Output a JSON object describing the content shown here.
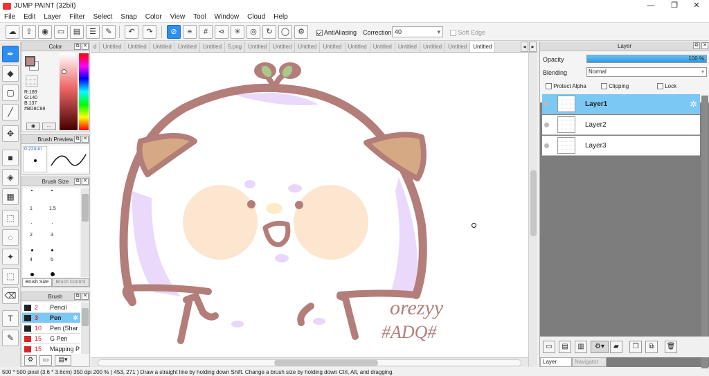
{
  "app": {
    "title": "JUMP PAINT (32bit)"
  },
  "window_controls": {
    "minimize": "—",
    "restore": "❐",
    "close": "✕"
  },
  "menu": [
    "File",
    "Edit",
    "Layer",
    "Filter",
    "Select",
    "Snap",
    "Color",
    "View",
    "Tool",
    "Window",
    "Cloud",
    "Help"
  ],
  "toolbar": {
    "antialiasing_label": "AntiAliasing",
    "antialiasing_checked": true,
    "correction_label": "Correction",
    "correction_value": "40",
    "soft_edge_label": "Soft Edge",
    "soft_edge_checked": false
  },
  "color_panel": {
    "title": "Color",
    "r": "R:189",
    "g": "G:140",
    "b": "B:137",
    "hex": "#BD8C89",
    "main_color": "#bd8c89"
  },
  "brush_preview": {
    "title": "Brush Preview",
    "size": "0.22mm"
  },
  "brush_size": {
    "title": "Brush Size",
    "values": [
      "1",
      "1.5",
      "·",
      "·",
      "2",
      "3",
      "4",
      "5"
    ],
    "tab_size": "Brush Size",
    "tab_control": "Brush Control"
  },
  "brush_panel": {
    "title": "Brush",
    "items": [
      {
        "num": "2",
        "name": "Pencil",
        "color": "#222222"
      },
      {
        "num": "3",
        "name": "Pen",
        "color": "#222222"
      },
      {
        "num": "10",
        "name": "Pen (Shar",
        "color": "#222222"
      },
      {
        "num": "15",
        "name": "G Pen",
        "color": "#d6242b"
      },
      {
        "num": "15",
        "name": "Mapping P",
        "color": "#d6242b"
      }
    ],
    "selected_index": 1
  },
  "tabs": [
    "d",
    "Untitled",
    "Untitled",
    "Untitled",
    "Untitled",
    "Untitled",
    "5.png",
    "Untitled",
    "Untitled",
    "Untitled",
    "Untitled",
    "Untitled",
    "Untitled",
    "Untitled",
    "Untitled",
    "Untitled",
    "Untitled"
  ],
  "active_tab_index": 16,
  "canvas": {
    "signature_line1": "orezyy",
    "signature_line2": "#ADQ#"
  },
  "layer_panel": {
    "title": "Layer",
    "opacity_label": "Opacity",
    "opacity_value": "100 %",
    "opacity_fraction": 1.0,
    "blending_label": "Blending",
    "blending_value": "Normal",
    "protect_alpha": "Protect Alpha",
    "clipping": "Clipping",
    "lock": "Lock",
    "layers": [
      "Layer1",
      "Layer2",
      "Layer3"
    ],
    "selected_index": 0,
    "tab_layer": "Layer",
    "tab_navigator": "Navigator"
  },
  "statusbar": {
    "text": "500 * 500 pixel   (3.6 * 3.6cm)   350 dpi   200 %   ( 453, 271 )   Draw a straight line by holding down Shift. Change a brush size by holding down Ctrl, Alt, and dragging."
  }
}
